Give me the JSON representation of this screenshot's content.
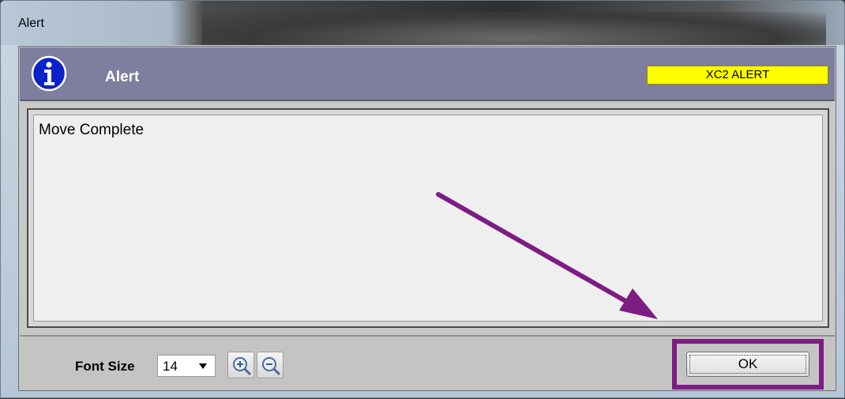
{
  "window": {
    "title": "Alert"
  },
  "header": {
    "title": "Alert",
    "badge": "XC2 ALERT",
    "icon": "info-icon"
  },
  "content": {
    "message": "Move Complete"
  },
  "footer": {
    "font_size_label": "Font Size",
    "font_size_value": "14",
    "zoom_in_icon": "zoom-in-icon",
    "zoom_out_icon": "zoom-out-icon",
    "ok_label": "OK"
  },
  "colors": {
    "header_bg": "#7e7e9e",
    "badge_bg": "#ffff00",
    "annotation": "#7d1d83",
    "info_icon_bg": "#0a22c8"
  }
}
